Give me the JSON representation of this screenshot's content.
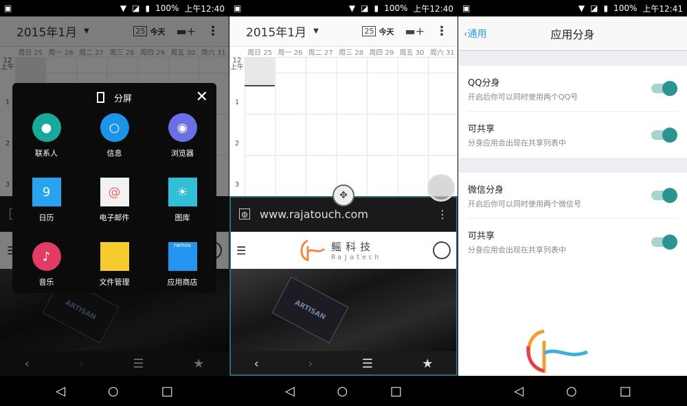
{
  "status_bars": [
    {
      "battery": "100%",
      "time": "上午12:40"
    },
    {
      "battery": "100%",
      "time": "上午12:40"
    },
    {
      "battery": "100%",
      "time": "上午12:41"
    }
  ],
  "calendar": {
    "month": "2015年1月",
    "today_icon_day": "25",
    "today_label": "今天",
    "days": [
      "周日 25",
      "周一 26",
      "周二 27",
      "周三 28",
      "周四 29",
      "周五 30",
      "周六 31"
    ],
    "hours": [
      "12\n上午",
      "1",
      "2",
      "3"
    ]
  },
  "browser": {
    "url": "www.rajatouch.com",
    "logo_cn": "鳐科技",
    "logo_en": "Rajatech",
    "photo_text": "ARTISAN"
  },
  "split_menu": {
    "title": "分屏",
    "apps": [
      {
        "label": "联系人",
        "color": "#19a99a",
        "icon": "contacts-icon"
      },
      {
        "label": "信息",
        "color": "#1b95e8",
        "icon": "messages-icon"
      },
      {
        "label": "浏览器",
        "color": "#6a6fe6",
        "icon": "browser-icon"
      },
      {
        "label": "日历",
        "color": "#27a3f0",
        "icon": "calendar-icon"
      },
      {
        "label": "电子邮件",
        "color": "#f2f2f2",
        "icon": "email-icon"
      },
      {
        "label": "图库",
        "color": "#2fc0d8",
        "icon": "gallery-icon"
      },
      {
        "label": "音乐",
        "color": "#e33c64",
        "icon": "music-icon"
      },
      {
        "label": "文件管理",
        "color": "#f7cc2e",
        "icon": "folder-icon"
      },
      {
        "label": "应用商店",
        "color": "#2596f0",
        "icon": "store-icon",
        "badge": "ramos"
      }
    ]
  },
  "settings": {
    "back_label": "通用",
    "title": "应用分身",
    "groups": [
      [
        {
          "title": "QQ分身",
          "subtitle": "开启后你可以同时使用两个QQ号",
          "on": true
        },
        {
          "title": "可共享",
          "subtitle": "分身应用会出现在共享列表中",
          "on": true
        }
      ],
      [
        {
          "title": "微信分身",
          "subtitle": "开启后你可以同时使用两个微信号",
          "on": true
        },
        {
          "title": "可共享",
          "subtitle": "分身应用会出现在共享列表中",
          "on": true
        }
      ]
    ],
    "toggle_color": "#2a9490"
  }
}
